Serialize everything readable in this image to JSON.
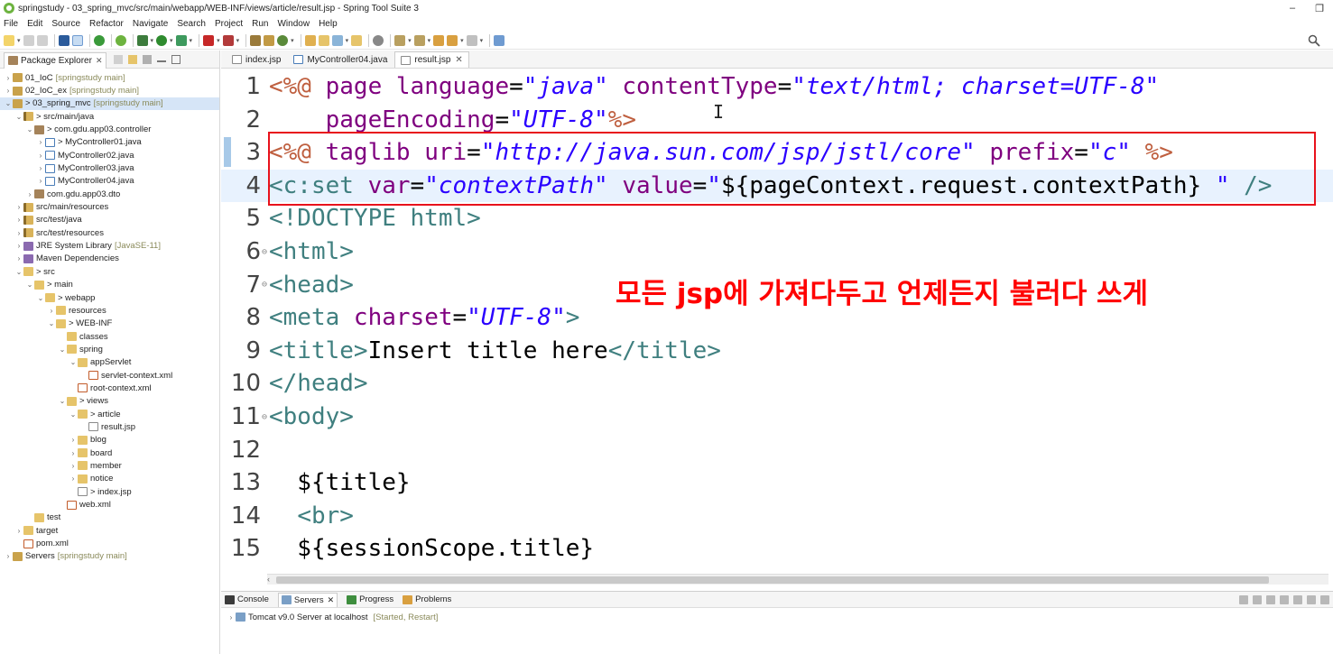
{
  "window": {
    "title": "springstudy - 03_spring_mvc/src/main/webapp/WEB-INF/views/article/result.jsp - Spring Tool Suite 3",
    "minimize": "–",
    "restore": "❐"
  },
  "menu": [
    "File",
    "Edit",
    "Source",
    "Refactor",
    "Navigate",
    "Search",
    "Project",
    "Run",
    "Window",
    "Help"
  ],
  "explorer": {
    "tab_label": "Package Explorer",
    "items": [
      {
        "label": "01_IoC",
        "suffix": "[springstudy main]",
        "depth": 0,
        "arrow": "›",
        "icon": "project"
      },
      {
        "label": "02_IoC_ex",
        "suffix": "[springstudy main]",
        "depth": 0,
        "arrow": "›",
        "icon": "project"
      },
      {
        "label": "> 03_spring_mvc",
        "suffix": "[springstudy main]",
        "depth": 0,
        "arrow": "⌄",
        "icon": "project",
        "selected": true
      },
      {
        "label": "> src/main/java",
        "suffix": "",
        "depth": 1,
        "arrow": "⌄",
        "icon": "srcfolder"
      },
      {
        "label": "> com.gdu.app03.controller",
        "suffix": "",
        "depth": 2,
        "arrow": "⌄",
        "icon": "package"
      },
      {
        "label": "> MyController01.java",
        "suffix": "",
        "depth": 3,
        "arrow": "›",
        "icon": "java"
      },
      {
        "label": "MyController02.java",
        "suffix": "",
        "depth": 3,
        "arrow": "›",
        "icon": "java"
      },
      {
        "label": "MyController03.java",
        "suffix": "",
        "depth": 3,
        "arrow": "›",
        "icon": "java"
      },
      {
        "label": "MyController04.java",
        "suffix": "",
        "depth": 3,
        "arrow": "›",
        "icon": "java"
      },
      {
        "label": "com.gdu.app03.dto",
        "suffix": "",
        "depth": 2,
        "arrow": "›",
        "icon": "package"
      },
      {
        "label": "src/main/resources",
        "suffix": "",
        "depth": 1,
        "arrow": "›",
        "icon": "srcfolder"
      },
      {
        "label": "src/test/java",
        "suffix": "",
        "depth": 1,
        "arrow": "›",
        "icon": "srcfolder"
      },
      {
        "label": "src/test/resources",
        "suffix": "",
        "depth": 1,
        "arrow": "›",
        "icon": "srcfolder"
      },
      {
        "label": "JRE System Library",
        "suffix": "[JavaSE-11]",
        "depth": 1,
        "arrow": "›",
        "icon": "lib"
      },
      {
        "label": "Maven Dependencies",
        "suffix": "",
        "depth": 1,
        "arrow": "›",
        "icon": "lib"
      },
      {
        "label": "> src",
        "suffix": "",
        "depth": 1,
        "arrow": "⌄",
        "icon": "folder"
      },
      {
        "label": "> main",
        "suffix": "",
        "depth": 2,
        "arrow": "⌄",
        "icon": "folder"
      },
      {
        "label": "> webapp",
        "suffix": "",
        "depth": 3,
        "arrow": "⌄",
        "icon": "folder"
      },
      {
        "label": "resources",
        "suffix": "",
        "depth": 4,
        "arrow": "›",
        "icon": "folder"
      },
      {
        "label": "> WEB-INF",
        "suffix": "",
        "depth": 4,
        "arrow": "⌄",
        "icon": "folder"
      },
      {
        "label": "classes",
        "suffix": "",
        "depth": 5,
        "arrow": "",
        "icon": "folder"
      },
      {
        "label": "spring",
        "suffix": "",
        "depth": 5,
        "arrow": "⌄",
        "icon": "folder"
      },
      {
        "label": "appServlet",
        "suffix": "",
        "depth": 6,
        "arrow": "⌄",
        "icon": "folder"
      },
      {
        "label": "servlet-context.xml",
        "suffix": "",
        "depth": 7,
        "arrow": "",
        "icon": "xml"
      },
      {
        "label": "root-context.xml",
        "suffix": "",
        "depth": 6,
        "arrow": "",
        "icon": "xml"
      },
      {
        "label": "> views",
        "suffix": "",
        "depth": 5,
        "arrow": "⌄",
        "icon": "folder"
      },
      {
        "label": "> article",
        "suffix": "",
        "depth": 6,
        "arrow": "⌄",
        "icon": "folder"
      },
      {
        "label": "result.jsp",
        "suffix": "",
        "depth": 7,
        "arrow": "",
        "icon": "jsp"
      },
      {
        "label": "blog",
        "suffix": "",
        "depth": 6,
        "arrow": "›",
        "icon": "folder"
      },
      {
        "label": "board",
        "suffix": "",
        "depth": 6,
        "arrow": "›",
        "icon": "folder"
      },
      {
        "label": "member",
        "suffix": "",
        "depth": 6,
        "arrow": "›",
        "icon": "folder"
      },
      {
        "label": "notice",
        "suffix": "",
        "depth": 6,
        "arrow": "›",
        "icon": "folder"
      },
      {
        "label": "> index.jsp",
        "suffix": "",
        "depth": 6,
        "arrow": "",
        "icon": "jsp"
      },
      {
        "label": "web.xml",
        "suffix": "",
        "depth": 5,
        "arrow": "",
        "icon": "xml"
      },
      {
        "label": "test",
        "suffix": "",
        "depth": 2,
        "arrow": "",
        "icon": "folder"
      },
      {
        "label": "target",
        "suffix": "",
        "depth": 1,
        "arrow": "›",
        "icon": "folder"
      },
      {
        "label": "pom.xml",
        "suffix": "",
        "depth": 1,
        "arrow": "",
        "icon": "xml"
      },
      {
        "label": "Servers",
        "suffix": "[springstudy main]",
        "depth": 0,
        "arrow": "›",
        "icon": "project"
      }
    ]
  },
  "editor_tabs": [
    {
      "label": "index.jsp",
      "icon": "jsp",
      "active": false
    },
    {
      "label": "MyController04.java",
      "icon": "java",
      "active": false
    },
    {
      "label": "result.jsp",
      "icon": "jsp",
      "active": true
    }
  ],
  "code_lines": [
    {
      "n": "1",
      "fold": "",
      "tokens": [
        [
          "dir",
          "<%@ "
        ],
        [
          "attr",
          "page "
        ],
        [
          "attr",
          "language"
        ],
        [
          "text",
          "="
        ],
        [
          "val",
          "\"java\""
        ],
        [
          "text",
          " "
        ],
        [
          "attr",
          "contentType"
        ],
        [
          "text",
          "="
        ],
        [
          "val",
          "\"text/html; charset=UTF-8\""
        ]
      ]
    },
    {
      "n": "2",
      "fold": "",
      "tokens": [
        [
          "text",
          "    "
        ],
        [
          "attr",
          "pageEncoding"
        ],
        [
          "text",
          "="
        ],
        [
          "val",
          "\"UTF-8\""
        ],
        [
          "dir",
          "%>"
        ]
      ]
    },
    {
      "n": "3",
      "fold": "",
      "tokens": [
        [
          "dir",
          "<%@ "
        ],
        [
          "attr",
          "taglib "
        ],
        [
          "attr",
          "uri"
        ],
        [
          "text",
          "="
        ],
        [
          "val",
          "\"http://java.sun.com/jsp/jstl/core\""
        ],
        [
          "text",
          " "
        ],
        [
          "attr",
          "prefix"
        ],
        [
          "text",
          "="
        ],
        [
          "val",
          "\"c\""
        ],
        [
          "text",
          " "
        ],
        [
          "dir",
          "%>"
        ]
      ]
    },
    {
      "n": "4",
      "fold": "",
      "highlight": true,
      "tokens": [
        [
          "el",
          "<c:set "
        ],
        [
          "attr",
          "var"
        ],
        [
          "text",
          "="
        ],
        [
          "val",
          "\"contextPath\""
        ],
        [
          "text",
          " "
        ],
        [
          "attr",
          "value"
        ],
        [
          "text",
          "="
        ],
        [
          "val",
          "\""
        ],
        [
          "text",
          "${pageContext.request.contextPath}"
        ],
        [
          "val",
          " \""
        ],
        [
          "text",
          " "
        ],
        [
          "el",
          "/>"
        ]
      ]
    },
    {
      "n": "5",
      "fold": "",
      "tokens": [
        [
          "el",
          "<!DOCTYPE html>"
        ]
      ]
    },
    {
      "n": "6",
      "fold": "⊖",
      "tokens": [
        [
          "el",
          "<html>"
        ]
      ]
    },
    {
      "n": "7",
      "fold": "⊖",
      "tokens": [
        [
          "el",
          "<head>"
        ]
      ]
    },
    {
      "n": "8",
      "fold": "",
      "tokens": [
        [
          "el",
          "<meta "
        ],
        [
          "attr",
          "charset"
        ],
        [
          "text",
          "="
        ],
        [
          "val",
          "\"UTF-8\""
        ],
        [
          "el",
          ">"
        ]
      ]
    },
    {
      "n": "9",
      "fold": "",
      "tokens": [
        [
          "el",
          "<title>"
        ],
        [
          "text",
          "Insert title here"
        ],
        [
          "el",
          "</title>"
        ]
      ]
    },
    {
      "n": "10",
      "fold": "",
      "tokens": [
        [
          "el",
          "</head>"
        ]
      ]
    },
    {
      "n": "11",
      "fold": "⊖",
      "tokens": [
        [
          "el",
          "<body>"
        ]
      ]
    },
    {
      "n": "12",
      "fold": "",
      "tokens": []
    },
    {
      "n": "13",
      "fold": "",
      "tokens": [
        [
          "text",
          "  ${title}"
        ]
      ]
    },
    {
      "n": "14",
      "fold": "",
      "tokens": [
        [
          "text",
          "  "
        ],
        [
          "el",
          "<br>"
        ]
      ]
    },
    {
      "n": "15",
      "fold": "",
      "tokens": [
        [
          "text",
          "  ${sessionScope.title}"
        ]
      ]
    }
  ],
  "annotation": "모든 jsp에 가져다두고 언제든지 불러다 쓰게",
  "bottom_panel": {
    "tabs": [
      {
        "label": "Console",
        "icon": "console",
        "active": false
      },
      {
        "label": "Servers",
        "icon": "server",
        "active": true
      },
      {
        "label": "Progress",
        "icon": "progress",
        "active": false
      },
      {
        "label": "Problems",
        "icon": "problems",
        "active": false
      }
    ],
    "server": {
      "label": "Tomcat v9.0 Server at localhost",
      "status": "[Started, Restart]"
    }
  },
  "colors": {
    "highlight_box": "#e8121c",
    "annotation": "#ff0000",
    "current_line": "#e8f2fe"
  }
}
